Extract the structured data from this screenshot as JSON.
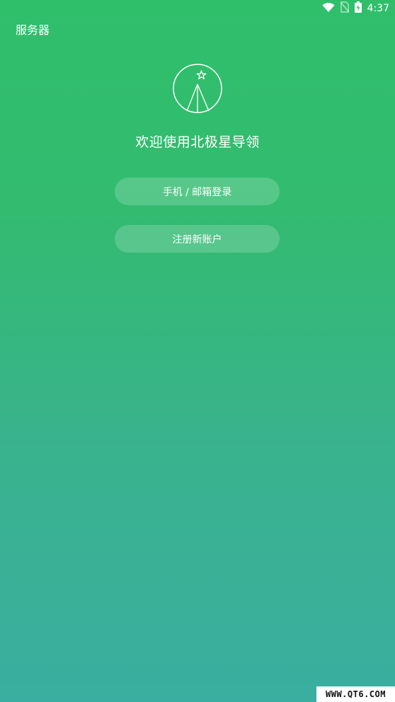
{
  "status_bar": {
    "time": "4:37",
    "icons": [
      "wifi-icon",
      "no-sim-icon",
      "battery-charging-icon"
    ]
  },
  "header": {
    "server_label": "服务器"
  },
  "logo": {
    "icon": "polaris-star-logo"
  },
  "welcome": {
    "title": "欢迎使用北极星导领"
  },
  "actions": {
    "login_label": "手机 / 邮箱登录",
    "register_label": "注册新账户"
  },
  "watermark": {
    "text": "WWW.QT6.COM"
  },
  "colors": {
    "gradient_top": "#2fbf6b",
    "gradient_bottom": "#3aaea0",
    "text": "#ffffff",
    "button_bg": "rgba(255,255,255,0.18)"
  }
}
